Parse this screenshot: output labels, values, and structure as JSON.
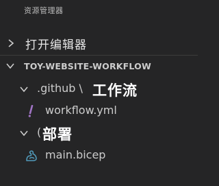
{
  "explorer": {
    "title": "资源管理器",
    "open_editors_label": "打开编辑器",
    "workspace_label": "TOY-WEBSITE-WORKFLOW",
    "tree": {
      "github_folder": {
        "label": ".github \\",
        "overlay_label": "工作流"
      },
      "workflow_file": {
        "label": "workflow.yml",
        "icon": "yaml-exclamation-icon"
      },
      "deploy_folder": {
        "label": "(",
        "overlay_label": "部署"
      },
      "bicep_file": {
        "label": "main.bicep",
        "icon": "bicep-icon"
      }
    }
  },
  "colors": {
    "background": "#252526",
    "text": "#cccccc",
    "yaml_icon": "#a074c4",
    "bicep_icon": "#519aba"
  }
}
